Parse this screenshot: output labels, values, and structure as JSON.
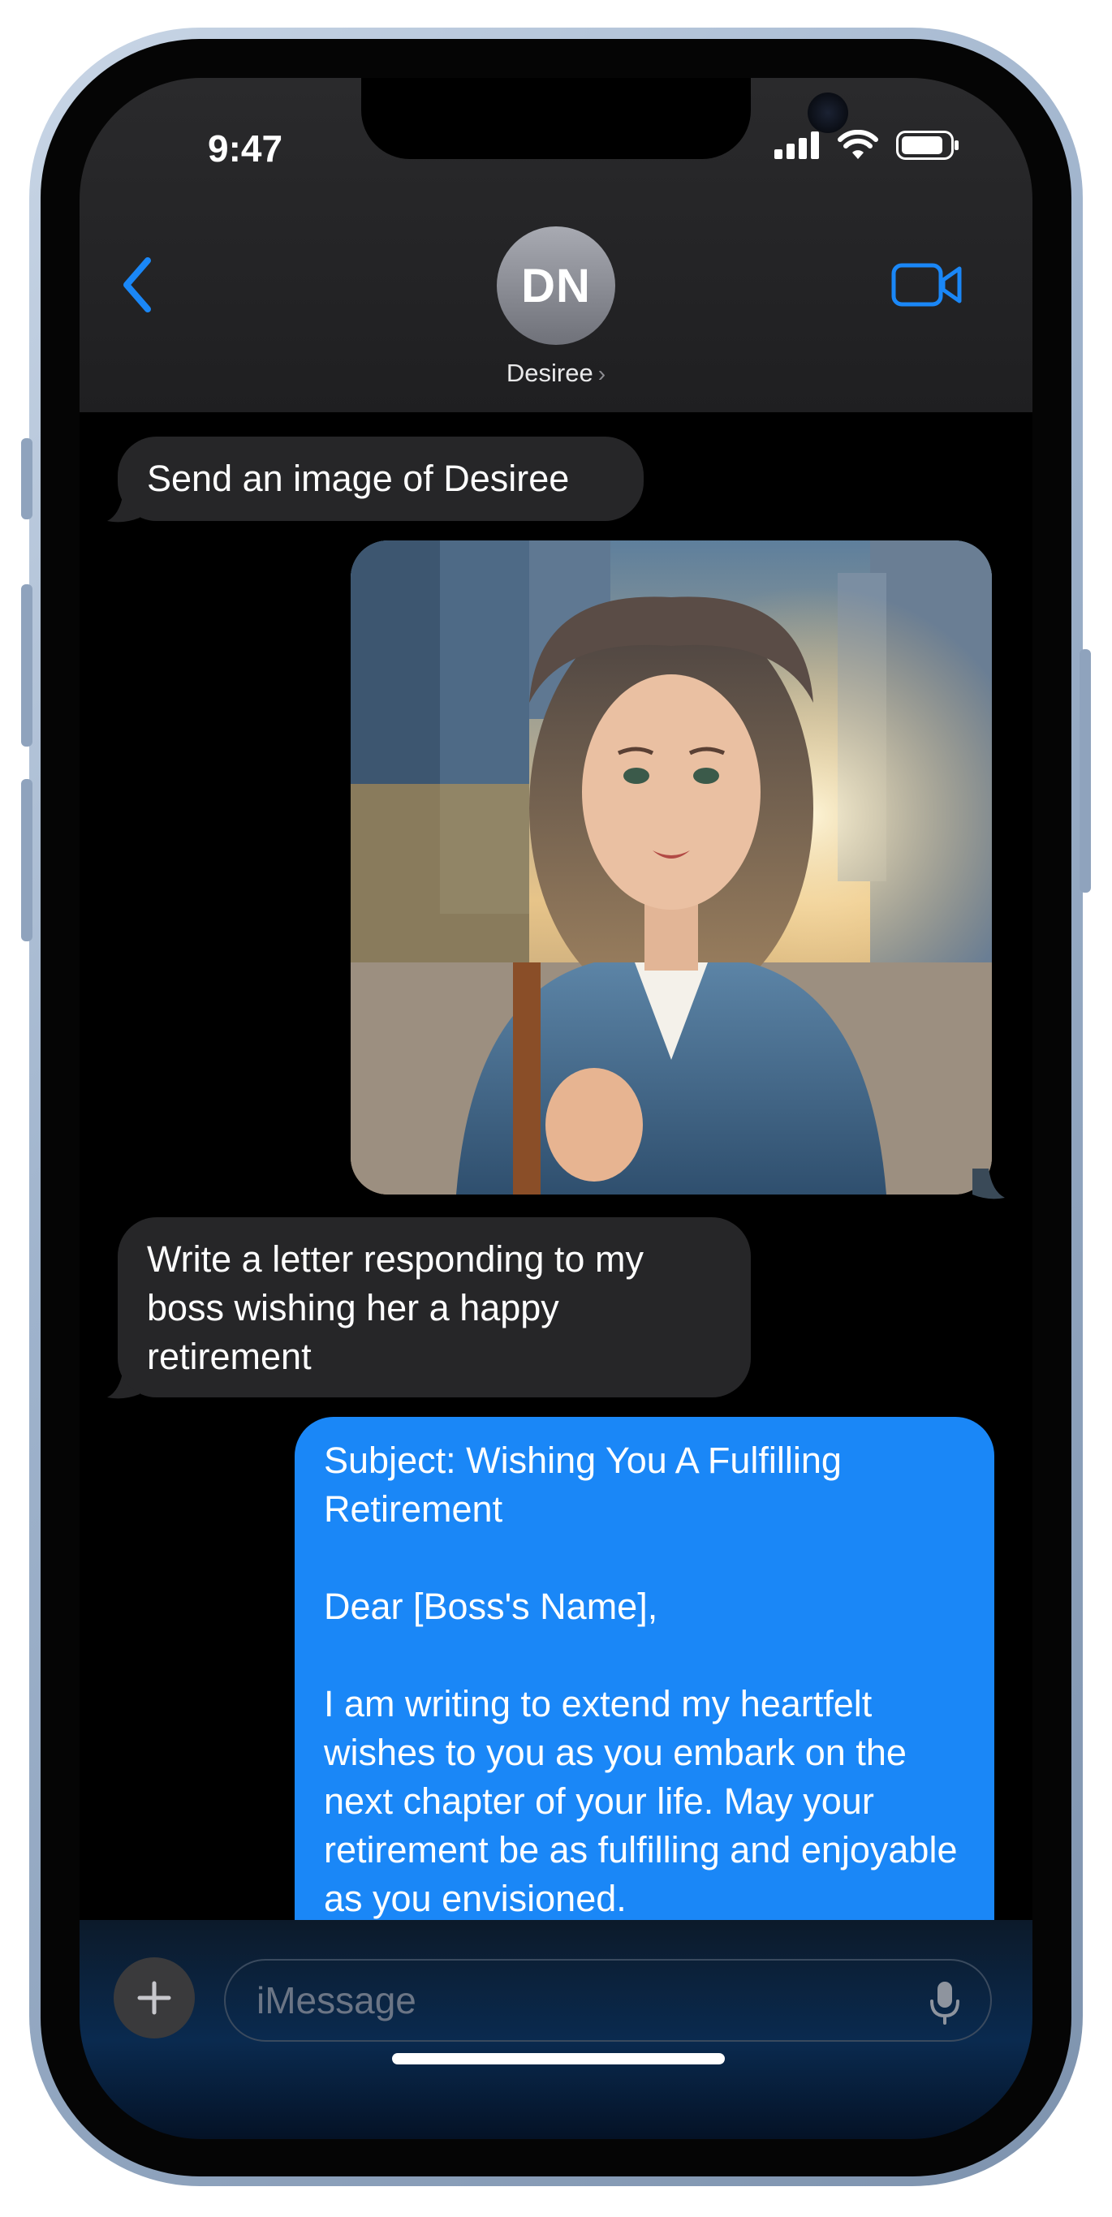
{
  "status_bar": {
    "time": "9:47"
  },
  "header": {
    "avatar_initials": "DN",
    "contact_name": "Desiree",
    "contact_chevron": "›"
  },
  "messages": {
    "incoming_1": "Send an image of Desiree",
    "incoming_2": "Write a letter responding to my boss wishing her a happy retirement",
    "outgoing_letter": {
      "p1": "Subject: Wishing You A Fulfilling Retirement",
      "p2": "Dear [Boss's Name],",
      "p3": "I am writing to extend my heartfelt wishes to you as you embark on the next chapter of your life. May your retirement be as fulfilling and enjoyable as you envisioned."
    }
  },
  "input": {
    "placeholder": "iMessage"
  },
  "colors": {
    "accent": "#1a87f7",
    "incoming_bubble": "#262628"
  },
  "icons": [
    "back-chevron-icon",
    "video-camera-icon",
    "plus-icon",
    "microphone-icon",
    "signal-icon",
    "wifi-icon",
    "battery-icon"
  ]
}
